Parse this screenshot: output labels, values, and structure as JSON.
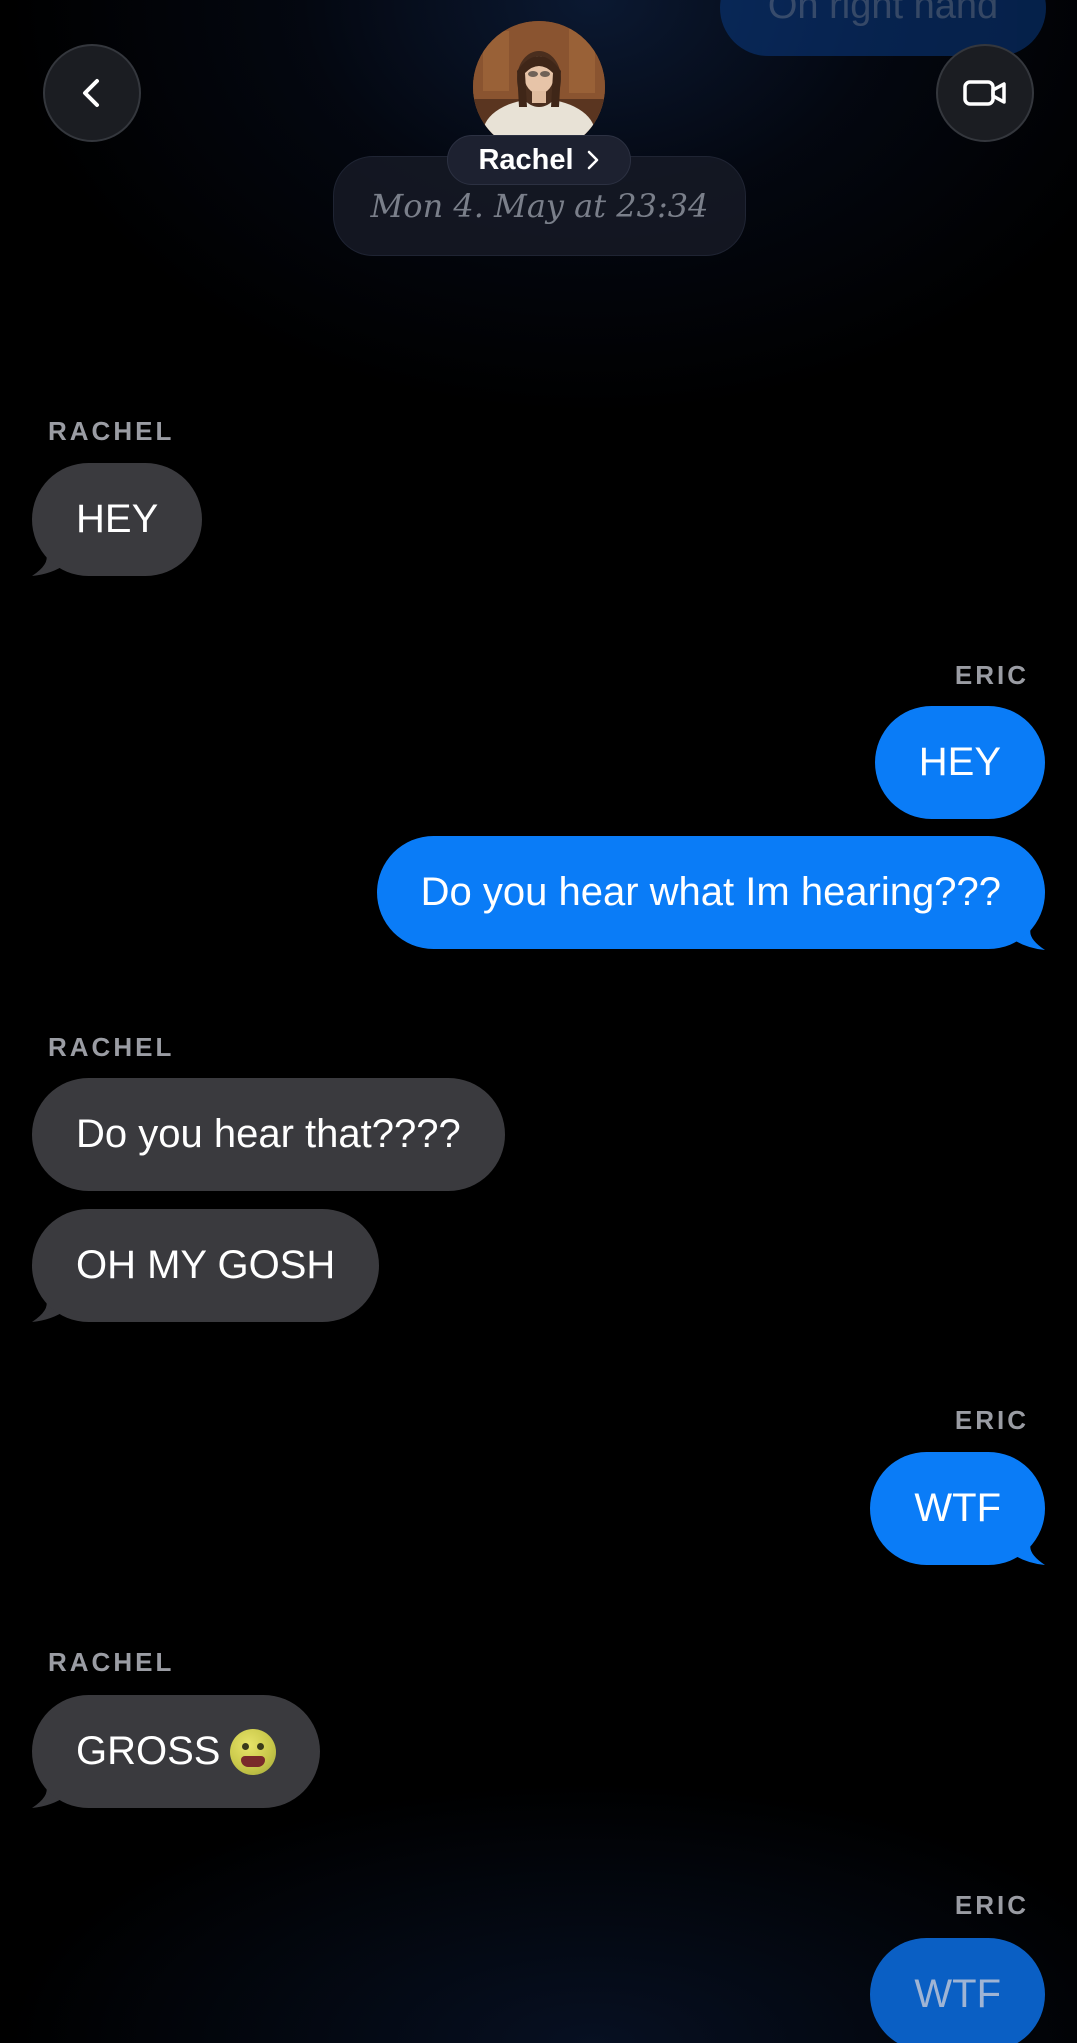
{
  "header": {
    "contact_name": "Rachel",
    "timestamp": "Mon 4. May at 23:34",
    "back_icon": "chevron-left-icon",
    "video_icon": "video-camera-icon",
    "name_chevron_icon": "chevron-right-icon",
    "top_partial_message": "Oh right hand"
  },
  "colors": {
    "outgoing_bubble": "#0a7cf7",
    "incoming_bubble": "#3a3a3e",
    "background": "#000000"
  },
  "messages": [
    {
      "sender": "RACHEL",
      "text": "HEY"
    },
    {
      "sender": "ERIC",
      "text": "HEY"
    },
    {
      "sender": "ERIC",
      "text": "Do you hear what Im hearing???"
    },
    {
      "sender": "RACHEL",
      "text": "Do you hear that????"
    },
    {
      "sender": "RACHEL",
      "text": "OH MY GOSH"
    },
    {
      "sender": "ERIC",
      "text": "WTF"
    },
    {
      "sender": "RACHEL",
      "text": "GROSS",
      "emoji": "nauseated-face"
    },
    {
      "sender": "ERIC",
      "text": "WTF"
    }
  ]
}
